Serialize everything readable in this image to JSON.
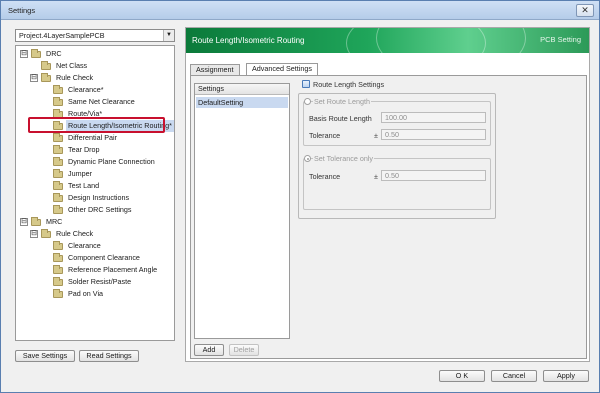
{
  "window": {
    "title": "Settings",
    "close_glyph": "✕"
  },
  "project": {
    "selected": "Project.4LayerSamplePCB",
    "arrow": "▼"
  },
  "tree": [
    {
      "label": "DRC",
      "level": 0,
      "expander": "⊟"
    },
    {
      "label": "Net Class",
      "level": 1
    },
    {
      "label": "Rule Check",
      "level": 1,
      "expander": "⊟"
    },
    {
      "label": "Clearance*",
      "level": 2
    },
    {
      "label": "Same Net Clearance",
      "level": 2
    },
    {
      "label": "Route/Via*",
      "level": 2
    },
    {
      "label": "Route Length/Isometric Routing*",
      "level": 2,
      "selected": true
    },
    {
      "label": "Differential Pair",
      "level": 2
    },
    {
      "label": "Tear Drop",
      "level": 2
    },
    {
      "label": "Dynamic Plane Connection",
      "level": 2
    },
    {
      "label": "Jumper",
      "level": 2
    },
    {
      "label": "Test Land",
      "level": 2
    },
    {
      "label": "Design Instructions",
      "level": 2
    },
    {
      "label": "Other DRC Settings",
      "level": 2
    },
    {
      "label": "MRC",
      "level": 0,
      "expander": "⊟"
    },
    {
      "label": "Rule Check",
      "level": 1,
      "expander": "⊟"
    },
    {
      "label": "Clearance",
      "level": 2
    },
    {
      "label": "Component Clearance",
      "level": 2
    },
    {
      "label": "Reference Placement Angle",
      "level": 2
    },
    {
      "label": "Solder Resist/Paste",
      "level": 2
    },
    {
      "label": "Pad on Via",
      "level": 2
    }
  ],
  "left_buttons": {
    "save": "Save Settings",
    "read": "Read Settings"
  },
  "banner": {
    "title": "Route Length/Isometric Routing",
    "product": "PCB Setting"
  },
  "tabs": {
    "assignment": "Assignment",
    "advanced": "Advanced Settings"
  },
  "settings_list": {
    "header": "Settings",
    "items": [
      "DefaultSetting"
    ]
  },
  "list_buttons": {
    "add": "Add",
    "delete": "Delete"
  },
  "route_length": {
    "group_label": "Route Length Settings",
    "set_route_length": "Set Route Length",
    "basis_label": "Basis Route Length",
    "basis_value": "100.00",
    "tolerance_label": "Tolerance",
    "pm": "±",
    "tolerance_value": "0.50",
    "set_tolerance_only": "Set Tolerance only",
    "tolerance_only_label": "Tolerance",
    "tolerance_only_value": "0.50"
  },
  "footer": {
    "ok": "O K",
    "cancel": "Cancel",
    "apply": "Apply"
  },
  "colors": {
    "highlight": "#c8102e",
    "banner": "#1fa55a",
    "selection": "#c9d9f0"
  }
}
